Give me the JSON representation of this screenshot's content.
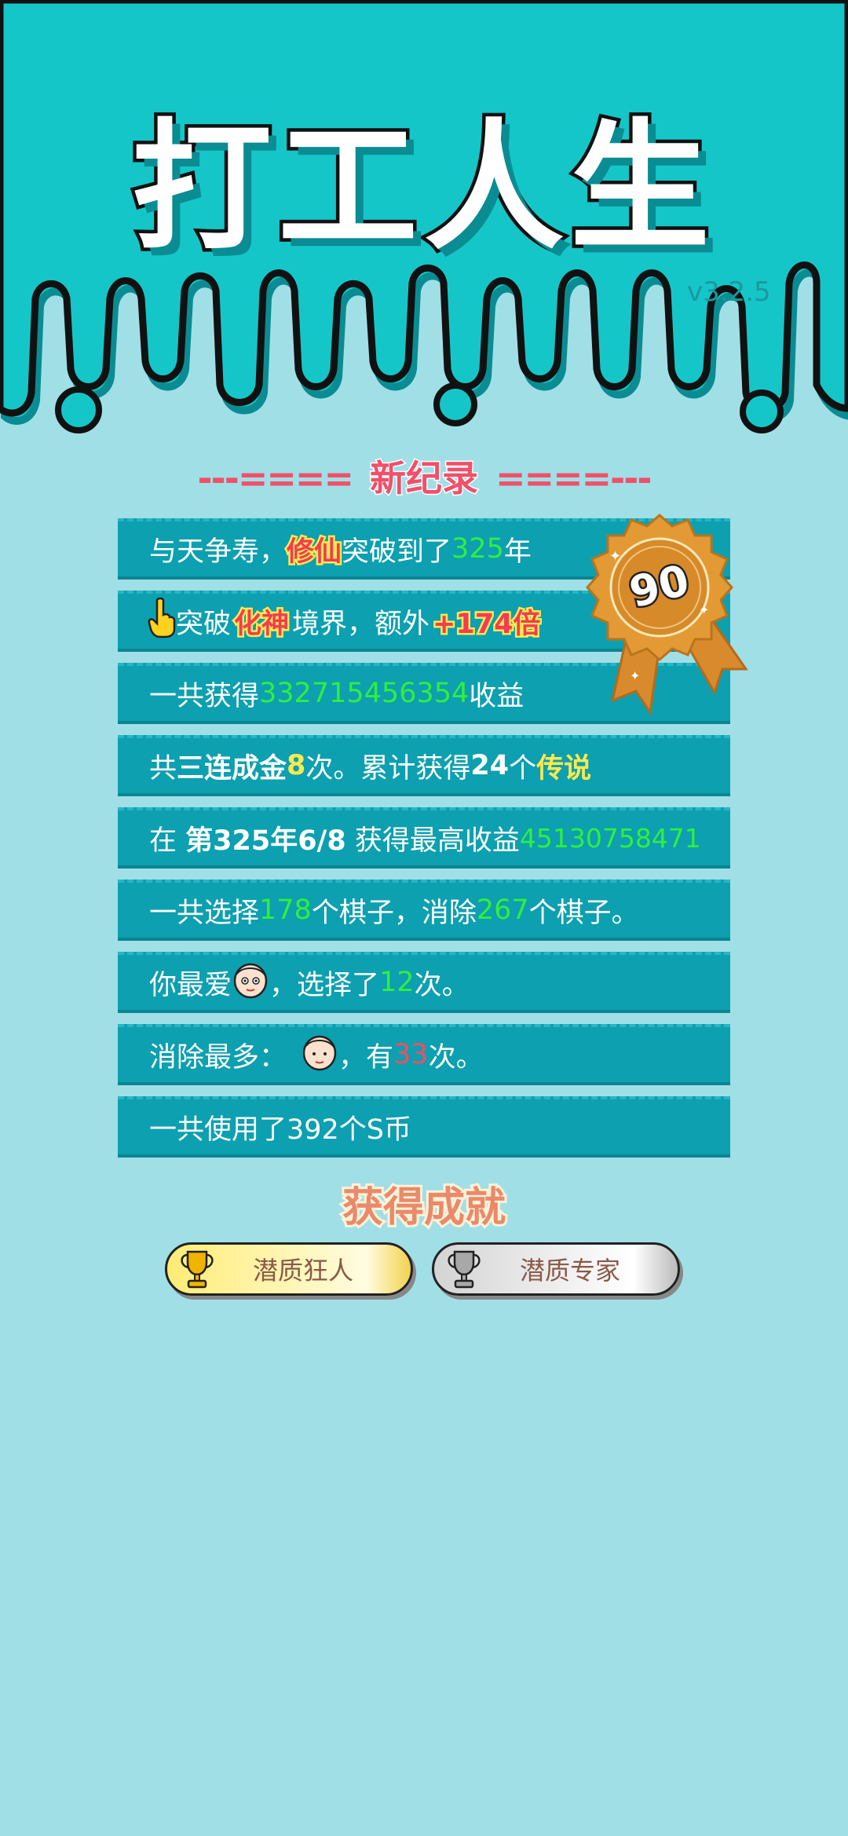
{
  "app": {
    "title": "打工人生",
    "version": "v3.2.5"
  },
  "record": {
    "dashes_left": "---====",
    "title": "新纪录",
    "dashes_right": "====---"
  },
  "medal": {
    "score": "90"
  },
  "stats": {
    "row1": {
      "a": "与天争寿，",
      "b": "修仙",
      "c": "突破到了",
      "d": "325",
      "e": "年"
    },
    "row2": {
      "a": "突破",
      "b": "化神",
      "c": "境界，额外",
      "d": "+174倍"
    },
    "row3": {
      "a": "一共获得",
      "b": "332715456354",
      "c": "收益"
    },
    "row4": {
      "a": "共",
      "b": "三连成金",
      "c": "8",
      "d": "次。累计获得",
      "e": "24",
      "f": "个",
      "g": "传说"
    },
    "row5": {
      "a": "在 ",
      "b": "第325年6/8",
      "c": " 获得最高收益",
      "d": "45130758471"
    },
    "row6": {
      "a": "一共选择",
      "b": "178",
      "c": "个棋子，消除",
      "d": "267",
      "e": "个棋子。"
    },
    "row7": {
      "a": "你最爱",
      "b": "，选择了",
      "c": "12",
      "d": "次。"
    },
    "row8": {
      "a": "消除最多：",
      "b": "，有",
      "c": "33",
      "d": "次。"
    },
    "row9": {
      "a": "一共使用了392个S币"
    }
  },
  "achievements": {
    "title": "获得成就",
    "items": [
      {
        "label": "潜质狂人",
        "tier": "gold"
      },
      {
        "label": "潜质专家",
        "tier": "silver"
      }
    ]
  },
  "colors": {
    "header_bg": "#15c6c8",
    "page_bg": "#a1dfe6",
    "row_bg": "#0ca0b0",
    "green": "#32ee3e",
    "red": "#ff4a62",
    "yellow": "#ffe94d",
    "medal": "#d98a2c"
  },
  "icons": [
    "pointing-hand-icon",
    "face-icon",
    "trophy-icon",
    "medal-icon"
  ]
}
